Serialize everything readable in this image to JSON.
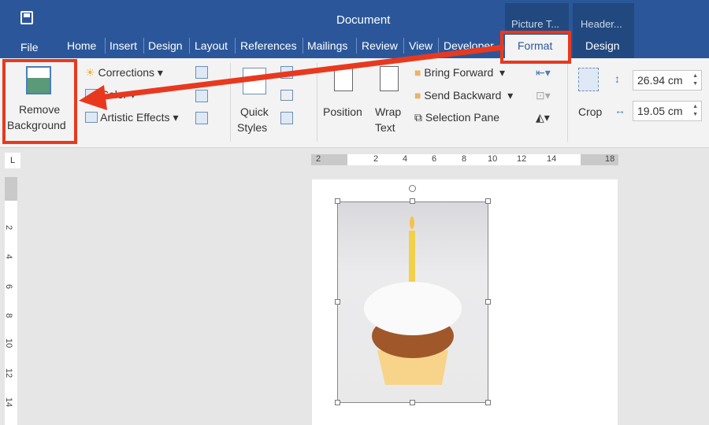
{
  "title": "Document",
  "tabs": [
    "File",
    "Home",
    "Insert",
    "Design",
    "Layout",
    "References",
    "Mailings",
    "Review",
    "View",
    "Developer"
  ],
  "context_tabs": [
    {
      "group": "Picture T...",
      "tab": "Format"
    },
    {
      "group": "Header...",
      "tab": "Design"
    }
  ],
  "ribbon": {
    "remove_bg_1": "Remove",
    "remove_bg_2": "Background",
    "corrections": "Corrections",
    "color": "Color",
    "artistic": "Artistic Effects",
    "quick_1": "Quick",
    "quick_2": "Styles",
    "position": "Position",
    "wrap_1": "Wrap",
    "wrap_2": "Text",
    "bring_forward": "Bring Forward",
    "send_backward": "Send Backward",
    "selection_pane": "Selection Pane",
    "crop": "Crop",
    "height": "26.94 cm",
    "width": "19.05 cm"
  },
  "ruler_h": [
    "2",
    "2",
    "4",
    "6",
    "8",
    "10",
    "12",
    "14",
    "18"
  ],
  "ruler_v": [
    "2",
    "4",
    "6",
    "8",
    "10",
    "12",
    "14"
  ],
  "colors": {
    "title": "#2b579a",
    "highlight": "#e8391f"
  }
}
